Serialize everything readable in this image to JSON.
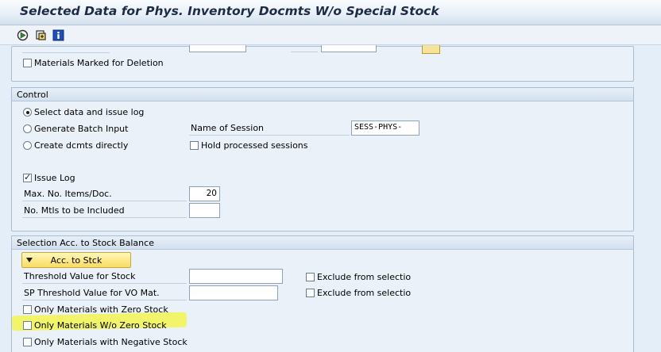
{
  "window": {
    "title": "Selected Data for Phys. Inventory Docmts W/o Special Stock"
  },
  "toolbar": {
    "icons": [
      "execute-icon",
      "variant-icon",
      "info-icon"
    ]
  },
  "top_group": {
    "materials_marked_deletion": {
      "label": "Materials Marked for Deletion",
      "checked": false
    }
  },
  "control": {
    "title": "Control",
    "radio_select": {
      "label": "Select data and issue log",
      "selected": true
    },
    "radio_batch": {
      "label": "Generate Batch Input",
      "selected": false
    },
    "radio_create": {
      "label": "Create dcmts directly",
      "selected": false
    },
    "session_label": "Name of Session",
    "session_value": "SESS-PHYS-",
    "hold_sessions": {
      "label": "Hold processed sessions",
      "checked": false
    },
    "issue_log": {
      "label": "Issue Log",
      "checked": true
    },
    "max_items_label": "Max. No. Items/Doc.",
    "max_items_value": "20",
    "no_mtls_label": "No. Mtls to be Included",
    "no_mtls_value": ""
  },
  "stock_balance": {
    "title": "Selection Acc. to Stock Balance",
    "acc_button": "Acc. to Stck",
    "threshold_label": "Threshold Value for Stock",
    "threshold_value": "",
    "threshold_exclude": "Exclude from selectio",
    "sp_threshold_label": "SP Threshold Value for VO Mat.",
    "sp_threshold_value": "",
    "sp_threshold_exclude": "Exclude from selectio",
    "only_zero": {
      "label": "Only Materials with Zero Stock",
      "checked": false
    },
    "only_wo_zero": {
      "label": "Only Materials W/o Zero Stock",
      "checked": false
    },
    "only_negative": {
      "label": "Only Materials with Negative Stock",
      "checked": false
    }
  },
  "colors": {
    "background": "#e4eef8",
    "highlight": "#f4f43a",
    "button_yellow": "#fde98a"
  }
}
